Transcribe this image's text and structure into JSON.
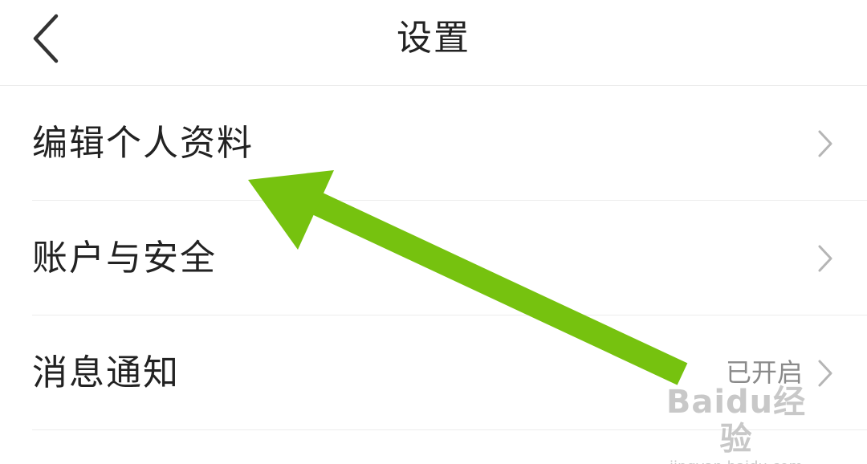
{
  "header": {
    "title": "设置",
    "back_icon": "chevron-left-icon"
  },
  "settings": {
    "items": [
      {
        "label": "编辑个人资料",
        "value": "",
        "icon": "chevron-right-icon"
      },
      {
        "label": "账户与安全",
        "value": "",
        "icon": "chevron-right-icon"
      },
      {
        "label": "消息通知",
        "value": "已开启",
        "icon": "chevron-right-icon"
      }
    ]
  },
  "overlay": {
    "arrow_color": "#76c20f"
  },
  "watermark": {
    "logo": "Baidu经验",
    "url": "jingyan.baidu.com"
  }
}
